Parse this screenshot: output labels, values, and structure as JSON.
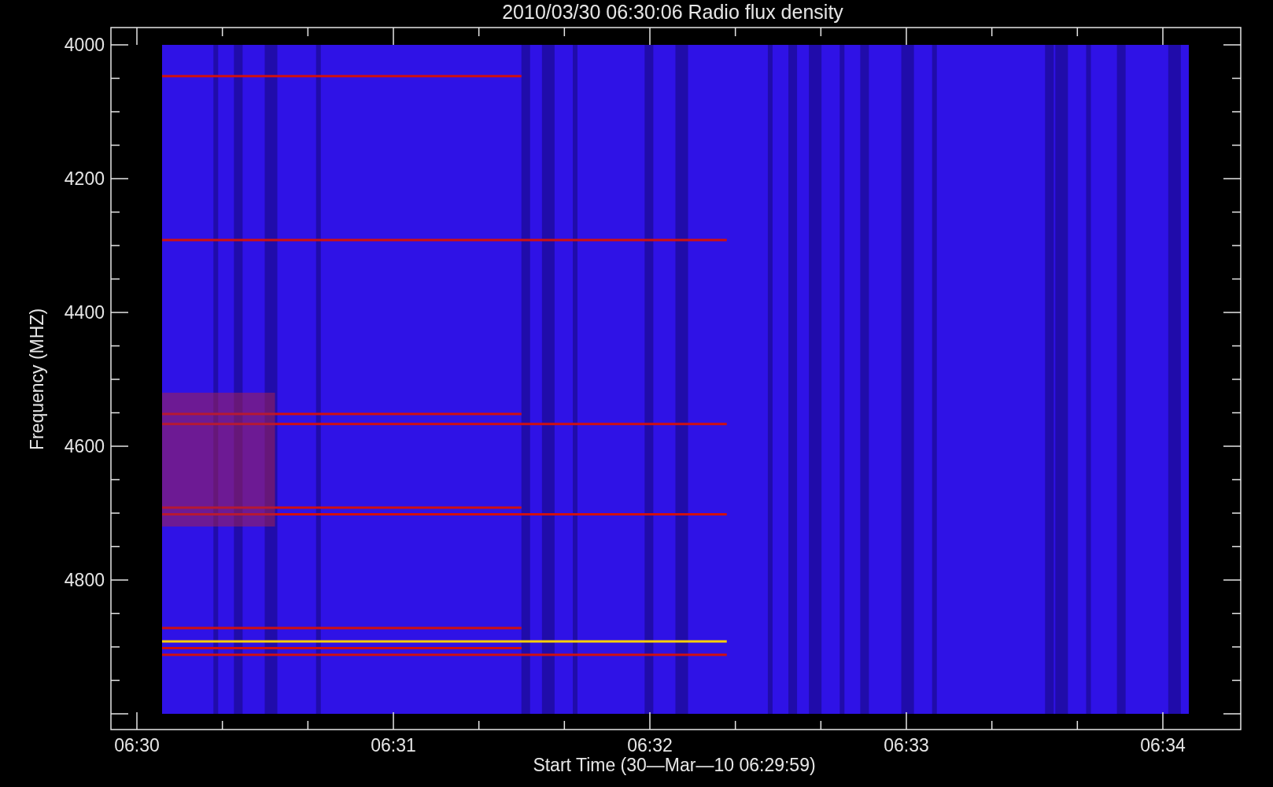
{
  "title": "2010/03/30 06:30:06 Radio flux density",
  "y_axis": {
    "label": "Frequency (MHZ)",
    "ticks": [
      "4000",
      "4200",
      "4400",
      "4600",
      "4800"
    ]
  },
  "x_axis": {
    "label": "Start Time (30—Mar—10 06:29:59)",
    "ticks": [
      "06:30",
      "06:31",
      "06:32",
      "06:33",
      "06:34"
    ]
  }
}
